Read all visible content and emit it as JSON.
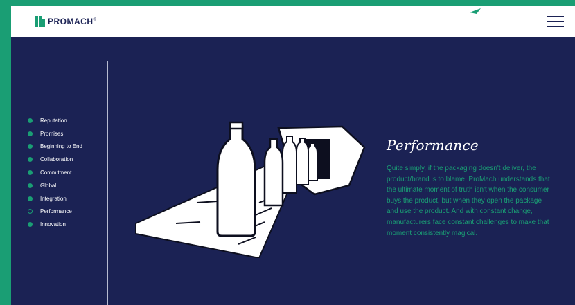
{
  "header": {
    "logo_text": "PROMACH",
    "logo_reg": "®",
    "menu_icon": "hamburger-menu-icon"
  },
  "sidenav": {
    "items": [
      {
        "label": "Reputation",
        "active": false
      },
      {
        "label": "Promises",
        "active": false
      },
      {
        "label": "Beginning to End",
        "active": false
      },
      {
        "label": "Collaboration",
        "active": false
      },
      {
        "label": "Commitment",
        "active": false
      },
      {
        "label": "Global",
        "active": false
      },
      {
        "label": "Integration",
        "active": false
      },
      {
        "label": "Performance",
        "active": true
      },
      {
        "label": "Innovation",
        "active": false
      }
    ]
  },
  "content": {
    "title": "Performance",
    "body": "Quite simply, if the packaging doesn't deliver, the product/brand is to blame. ProMach understands that the ultimate moment of truth isn't when the consumer buys the product, but when they open the package and use the product. And with constant change, manufacturers face constant challenges to make that moment consistently magical."
  },
  "colors": {
    "brand_green": "#1a9e74",
    "navy": "#1b2254",
    "white": "#ffffff"
  },
  "illustration": "bottles-on-conveyor-sketch"
}
